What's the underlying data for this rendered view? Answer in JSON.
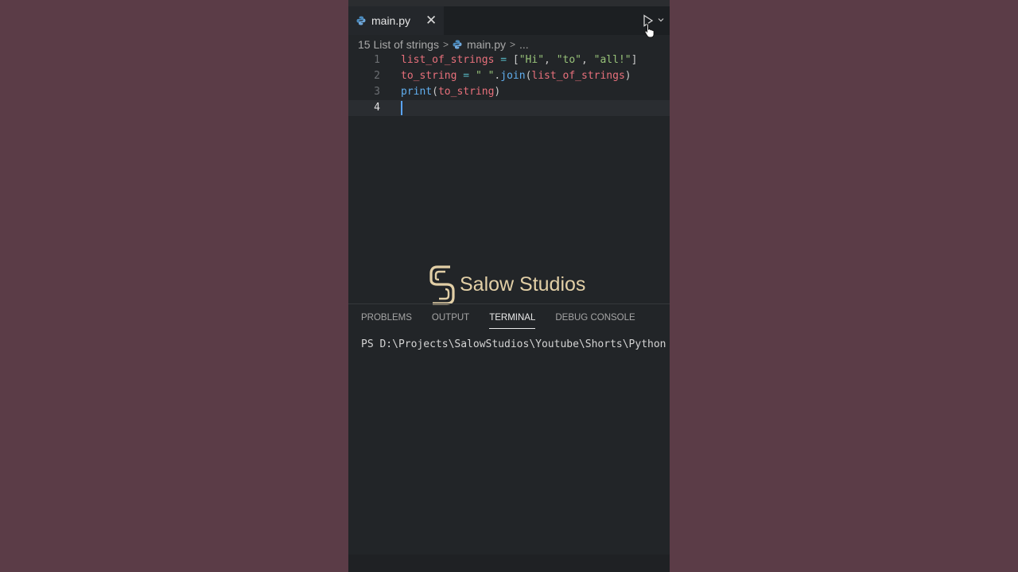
{
  "tab": {
    "filename": "main.py",
    "close_symbol": "✕"
  },
  "breadcrumb": {
    "folder": "15 List of strings",
    "file": "main.py",
    "more": "..."
  },
  "editor": {
    "lines": [
      {
        "number": "1"
      },
      {
        "number": "2"
      },
      {
        "number": "3"
      },
      {
        "number": "4"
      }
    ],
    "code": {
      "line1": {
        "var": "list_of_strings",
        "op": " = ",
        "open": "[",
        "s1": "\"Hi\"",
        "c1": ", ",
        "s2": "\"to\"",
        "c2": ", ",
        "s3": "\"all!\"",
        "close": "]"
      },
      "line2": {
        "var": "to_string",
        "op": " = ",
        "str": "\" \"",
        "dot": ".",
        "fn": "join",
        "open": "(",
        "arg": "list_of_strings",
        "close": ")"
      },
      "line3": {
        "fn": "print",
        "open": "(",
        "arg": "to_string",
        "close": ")"
      }
    }
  },
  "watermark": {
    "text": "Salow Studios"
  },
  "panel": {
    "tabs": [
      "PROBLEMS",
      "OUTPUT",
      "TERMINAL",
      "DEBUG CONSOLE"
    ],
    "active_tab": "TERMINAL",
    "terminal_text": "PS D:\\Projects\\SalowStudios\\Youtube\\Shorts\\Python"
  },
  "colors": {
    "background": "#5b3c47",
    "editor_bg": "#222528",
    "variable": "#e8707b",
    "string": "#98c379",
    "function": "#61afef",
    "logo": "#e2cfa6"
  }
}
